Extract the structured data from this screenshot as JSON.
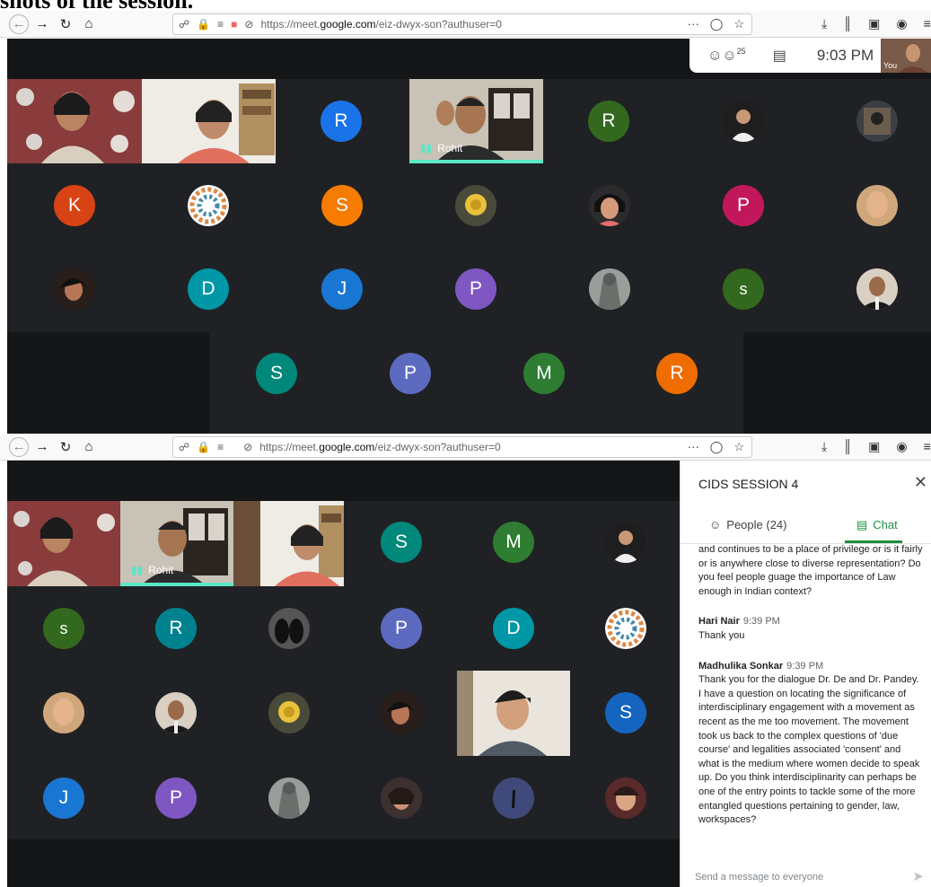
{
  "caption": "shots of the session.",
  "browser": {
    "url_prefix": "https://meet.",
    "url_domain": "google.com",
    "url_path": "/eiz-dwyx-son?authuser=0",
    "more_label": "···"
  },
  "top_screenshot": {
    "participant_count": "25",
    "clock": "9:03 PM",
    "self_label": "You",
    "speaker_name": "Rohit",
    "avatars": [
      {
        "letter": "R",
        "color": "#1a73e8"
      },
      {
        "letter": "R",
        "color": "#33691e"
      },
      {
        "letter": "K",
        "color": "#d84315"
      },
      {
        "letter": "S",
        "color": "#f57c00"
      },
      {
        "letter": "P",
        "color": "#c2185b"
      },
      {
        "letter": "D",
        "color": "#0097a7"
      },
      {
        "letter": "J",
        "color": "#1976d2"
      },
      {
        "letter": "P",
        "color": "#7e57c2"
      },
      {
        "letter": "s",
        "color": "#33691e"
      },
      {
        "letter": "S",
        "color": "#00897b"
      },
      {
        "letter": "P",
        "color": "#5c6bc0"
      },
      {
        "letter": "M",
        "color": "#2e7d32"
      },
      {
        "letter": "R",
        "color": "#ef6c00"
      }
    ]
  },
  "bottom_screenshot": {
    "speaker_name": "Rohit",
    "avatars": [
      {
        "letter": "S",
        "color": "#00897b"
      },
      {
        "letter": "M",
        "color": "#2e7d32"
      },
      {
        "letter": "s",
        "color": "#33691e"
      },
      {
        "letter": "R",
        "color": "#00838f"
      },
      {
        "letter": "P",
        "color": "#5c6bc0"
      },
      {
        "letter": "D",
        "color": "#0097a7"
      },
      {
        "letter": "S",
        "color": "#1565c0"
      },
      {
        "letter": "J",
        "color": "#1976d2"
      },
      {
        "letter": "P",
        "color": "#7e57c2"
      }
    ],
    "chat": {
      "title": "CIDS SESSION 4",
      "people_tab": "People (24)",
      "chat_tab": "Chat",
      "input_placeholder": "Send a message to everyone",
      "messages": [
        {
          "sender": "",
          "time": "",
          "text": "and continues to be a place of privilege or is it fairly or is anywhere close to diverse representation? Do you feel people guage the importance of Law enough in Indian context?"
        },
        {
          "sender": "Hari Nair",
          "time": "9:39 PM",
          "text": "Thank you"
        },
        {
          "sender": "Madhulika Sonkar",
          "time": "9:39 PM",
          "text": "Thank you for the dialogue Dr. De and Dr. Pandey. I have a question on locating the significance of interdisciplinary engagement with a movement as recent as the me too movement. The movement took us back to the complex questions of 'due course' and legalities associated 'consent' and what is the medium where women decide to speak up. Do you think interdisciplinarity can perhaps be one of the entry points to tackle some of the more entangled questions pertaining to gender, law, workspaces?"
        }
      ]
    }
  }
}
